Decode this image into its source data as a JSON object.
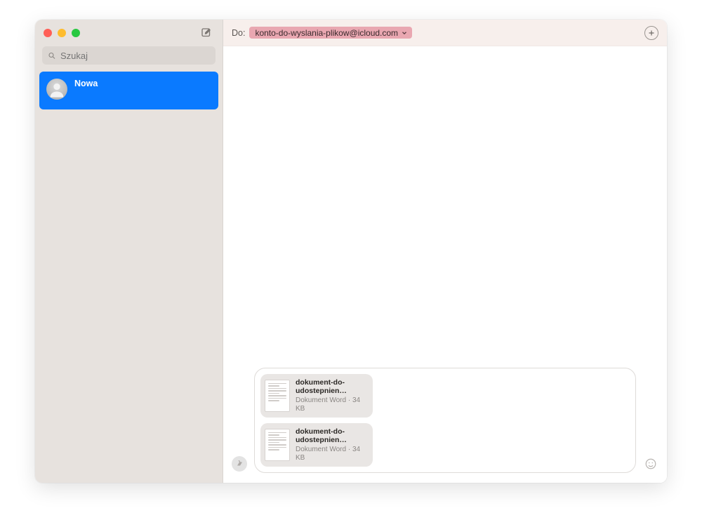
{
  "sidebar": {
    "search_placeholder": "Szukaj",
    "conversations": [
      {
        "title": "Nowa"
      }
    ]
  },
  "header": {
    "to_label": "Do:",
    "recipient": "konto-do-wyslania-plikow@icloud.com"
  },
  "composer": {
    "attachments": [
      {
        "name": "dokument-do-udostepnien…",
        "meta": "Dokument Word · 34 KB"
      },
      {
        "name": "dokument-do-udostepnien…",
        "meta": "Dokument Word · 34 KB"
      }
    ]
  }
}
